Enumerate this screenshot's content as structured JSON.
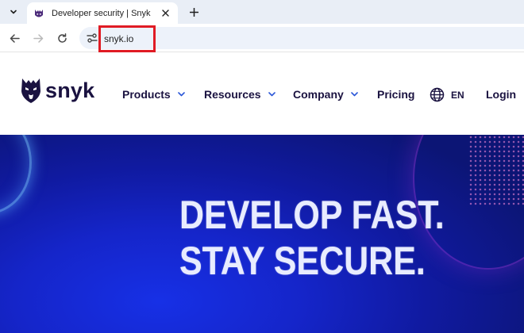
{
  "browser": {
    "tab": {
      "title": "Developer security | Snyk"
    },
    "address_bar": {
      "url": "snyk.io"
    }
  },
  "site": {
    "logo_text": "snyk",
    "nav": {
      "products": "Products",
      "resources": "Resources",
      "company": "Company",
      "pricing": "Pricing",
      "language": "EN",
      "login": "Login"
    }
  },
  "hero": {
    "line1": "DEVELOP FAST.",
    "line2": "STAY SECURE."
  },
  "colors": {
    "brand_navy": "#1a1240",
    "hero_blue": "#1525c9",
    "highlight_red": "#e01b24"
  },
  "icons": [
    "tab-list-icon",
    "snyk-favicon-icon",
    "close-icon",
    "plus-icon",
    "back-arrow-icon",
    "forward-arrow-icon",
    "reload-icon",
    "site-info-icon",
    "snyk-dog-logo-icon",
    "chevron-down-icon",
    "globe-icon"
  ]
}
